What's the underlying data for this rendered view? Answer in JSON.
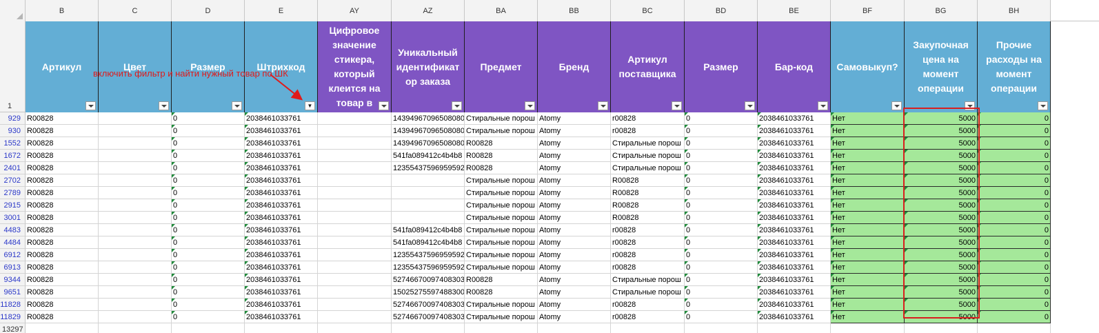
{
  "sheet": {
    "corner_label": "",
    "header_row_number": "1",
    "columns": [
      {
        "letter": "B",
        "title": "Артикул",
        "color": "blue",
        "filter_active": false
      },
      {
        "letter": "C",
        "title": "Цвет",
        "color": "blue",
        "filter_active": false
      },
      {
        "letter": "D",
        "title": "Размер",
        "color": "blue",
        "filter_active": false
      },
      {
        "letter": "E",
        "title": "Штрихкод",
        "color": "blue",
        "filter_active": true
      },
      {
        "letter": "AY",
        "title": "Цифровое\nзначение\nстикера,\nкоторый\nклеится на\nтовар в",
        "color": "purple",
        "filter_active": false
      },
      {
        "letter": "AZ",
        "title": "Уникальный\nидентификат\nор заказа",
        "color": "purple",
        "filter_active": false
      },
      {
        "letter": "BA",
        "title": "Предмет",
        "color": "purple",
        "filter_active": false
      },
      {
        "letter": "BB",
        "title": "Бренд",
        "color": "purple",
        "filter_active": false
      },
      {
        "letter": "BC",
        "title": "Артикул\nпоставщика",
        "color": "purple",
        "filter_active": false
      },
      {
        "letter": "BD",
        "title": "Размер",
        "color": "purple",
        "filter_active": false
      },
      {
        "letter": "BE",
        "title": "Бар-код",
        "color": "purple",
        "filter_active": false
      },
      {
        "letter": "BF",
        "title": "Самовыкуп?",
        "color": "blue",
        "filter_active": false
      },
      {
        "letter": "BG",
        "title": "Закупочная\nцена на\nмомент\nоперации",
        "color": "blue",
        "filter_active": false
      },
      {
        "letter": "BH",
        "title": "Прочие\nрасходы на\nмомент\nоперации",
        "color": "blue",
        "filter_active": false
      }
    ],
    "annotation": "включить фильтр и найти нужный товар по ШК",
    "rows": [
      {
        "n": "929",
        "B": "R00828",
        "C": "",
        "D": "0",
        "E": "2038461033761",
        "AY": "",
        "AZ": "14394967096508080",
        "BA": "Стиральные порош",
        "BB": "Atomy",
        "BC": "r00828",
        "BD": "0",
        "BE": "2038461033761",
        "BF": "Нет",
        "BG": "5000",
        "BH": "0"
      },
      {
        "n": "930",
        "B": "R00828",
        "C": "",
        "D": "0",
        "E": "2038461033761",
        "AY": "",
        "AZ": "14394967096508080",
        "BA": "Стиральные порош",
        "BB": "Atomy",
        "BC": "r00828",
        "BD": "0",
        "BE": "2038461033761",
        "BF": "Нет",
        "BG": "5000",
        "BH": "0"
      },
      {
        "n": "1552",
        "B": "R00828",
        "C": "",
        "D": "0",
        "E": "2038461033761",
        "AY": "",
        "AZ": "14394967096508080",
        "BA": "R00828",
        "BB": "Atomy",
        "BC": "Стиральные порош",
        "BD": "0",
        "BE": "2038461033761",
        "BF": "Нет",
        "BG": "5000",
        "BH": "0"
      },
      {
        "n": "1672",
        "B": "R00828",
        "C": "",
        "D": "0",
        "E": "2038461033761",
        "AY": "",
        "AZ": "541fa089412c4b4b8",
        "BA": "R00828",
        "BB": "Atomy",
        "BC": "Стиральные порош",
        "BD": "0",
        "BE": "2038461033761",
        "BF": "Нет",
        "BG": "5000",
        "BH": "0"
      },
      {
        "n": "2401",
        "B": "R00828",
        "C": "",
        "D": "0",
        "E": "2038461033761",
        "AY": "",
        "AZ": "12355437596959592",
        "BA": "R00828",
        "BB": "Atomy",
        "BC": "Стиральные порош",
        "BD": "0",
        "BE": "2038461033761",
        "BF": "Нет",
        "BG": "5000",
        "BH": "0"
      },
      {
        "n": "2702",
        "B": "R00828",
        "C": "",
        "D": "0",
        "E": "2038461033761",
        "AY": "",
        "AZ": "",
        "BA": "Стиральные порош",
        "BB": "Atomy",
        "BC": "R00828",
        "BD": "0",
        "BE": "2038461033761",
        "BF": "Нет",
        "BG": "5000",
        "BH": "0"
      },
      {
        "n": "2789",
        "B": "R00828",
        "C": "",
        "D": "0",
        "E": "2038461033761",
        "AY": "",
        "AZ": "",
        "BA": "Стиральные порош",
        "BB": "Atomy",
        "BC": "R00828",
        "BD": "0",
        "BE": "2038461033761",
        "BF": "Нет",
        "BG": "5000",
        "BH": "0"
      },
      {
        "n": "2915",
        "B": "R00828",
        "C": "",
        "D": "0",
        "E": "2038461033761",
        "AY": "",
        "AZ": "",
        "BA": "Стиральные порош",
        "BB": "Atomy",
        "BC": "R00828",
        "BD": "0",
        "BE": "2038461033761",
        "BF": "Нет",
        "BG": "5000",
        "BH": "0"
      },
      {
        "n": "3001",
        "B": "R00828",
        "C": "",
        "D": "0",
        "E": "2038461033761",
        "AY": "",
        "AZ": "",
        "BA": "Стиральные порош",
        "BB": "Atomy",
        "BC": "R00828",
        "BD": "0",
        "BE": "2038461033761",
        "BF": "Нет",
        "BG": "5000",
        "BH": "0"
      },
      {
        "n": "4483",
        "B": "R00828",
        "C": "",
        "D": "0",
        "E": "2038461033761",
        "AY": "",
        "AZ": "541fa089412c4b4b8",
        "BA": "Стиральные порош",
        "BB": "Atomy",
        "BC": "r00828",
        "BD": "0",
        "BE": "2038461033761",
        "BF": "Нет",
        "BG": "5000",
        "BH": "0"
      },
      {
        "n": "4484",
        "B": "R00828",
        "C": "",
        "D": "0",
        "E": "2038461033761",
        "AY": "",
        "AZ": "541fa089412c4b4b8",
        "BA": "Стиральные порош",
        "BB": "Atomy",
        "BC": "r00828",
        "BD": "0",
        "BE": "2038461033761",
        "BF": "Нет",
        "BG": "5000",
        "BH": "0"
      },
      {
        "n": "6912",
        "B": "R00828",
        "C": "",
        "D": "0",
        "E": "2038461033761",
        "AY": "",
        "AZ": "12355437596959592",
        "BA": "Стиральные порош",
        "BB": "Atomy",
        "BC": "r00828",
        "BD": "0",
        "BE": "2038461033761",
        "BF": "Нет",
        "BG": "5000",
        "BH": "0"
      },
      {
        "n": "6913",
        "B": "R00828",
        "C": "",
        "D": "0",
        "E": "2038461033761",
        "AY": "",
        "AZ": "12355437596959592",
        "BA": "Стиральные порош",
        "BB": "Atomy",
        "BC": "r00828",
        "BD": "0",
        "BE": "2038461033761",
        "BF": "Нет",
        "BG": "5000",
        "BH": "0"
      },
      {
        "n": "9344",
        "B": "R00828",
        "C": "",
        "D": "0",
        "E": "2038461033761",
        "AY": "",
        "AZ": "52746670097408303",
        "BA": "R00828",
        "BB": "Atomy",
        "BC": "Стиральные порош",
        "BD": "0",
        "BE": "2038461033761",
        "BF": "Нет",
        "BG": "5000",
        "BH": "0"
      },
      {
        "n": "9651",
        "B": "R00828",
        "C": "",
        "D": "0",
        "E": "2038461033761",
        "AY": "",
        "AZ": "15025275597488300",
        "BA": "R00828",
        "BB": "Atomy",
        "BC": "Стиральные порош",
        "BD": "0",
        "BE": "2038461033761",
        "BF": "Нет",
        "BG": "5000",
        "BH": "0"
      },
      {
        "n": "11828",
        "B": "R00828",
        "C": "",
        "D": "0",
        "E": "2038461033761",
        "AY": "",
        "AZ": "52746670097408303",
        "BA": "Стиральные порош",
        "BB": "Atomy",
        "BC": "r00828",
        "BD": "0",
        "BE": "2038461033761",
        "BF": "Нет",
        "BG": "5000",
        "BH": "0"
      },
      {
        "n": "11829",
        "B": "R00828",
        "C": "",
        "D": "0",
        "E": "2038461033761",
        "AY": "",
        "AZ": "52746670097408303",
        "BA": "Стиральные порош",
        "BB": "Atomy",
        "BC": "r00828",
        "BD": "0",
        "BE": "2038461033761",
        "BF": "Нет",
        "BG": "5000",
        "BH": "0"
      }
    ],
    "last_row_number": "13297",
    "colors": {
      "header_blue": "#63aed5",
      "header_purple": "#7f55c3",
      "highlight_green": "#a5e89a",
      "annotation_red": "#e01a1a",
      "row_number_blue": "#2a37c8"
    }
  }
}
